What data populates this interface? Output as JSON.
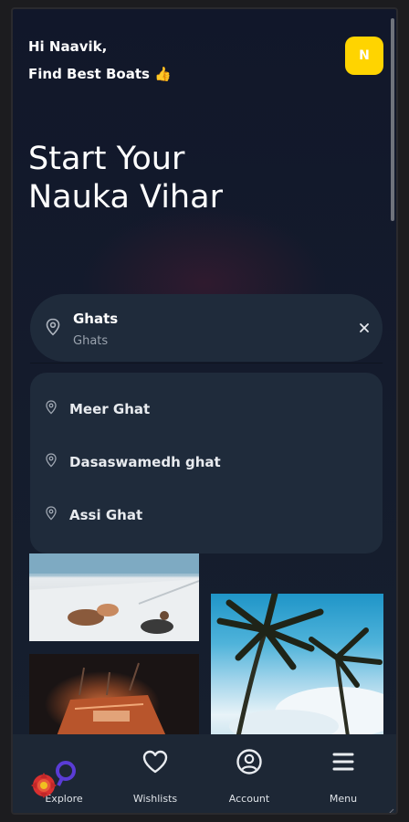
{
  "greeting": {
    "line1": "Hi Naavik,",
    "line2": "Find Best Boats 👍"
  },
  "avatar": {
    "initial": "N",
    "color": "#ffd400"
  },
  "hero": {
    "line1": "Start Your",
    "line2": "Nauka Vihar"
  },
  "search": {
    "title": "Ghats",
    "subtitle": "Ghats",
    "leading_icon": "location-pin-icon",
    "trailing_icon": "close-icon"
  },
  "suggestions": [
    {
      "label": "Meer Ghat",
      "icon": "location-pin-icon"
    },
    {
      "label": "Dasaswamedh ghat",
      "icon": "location-pin-icon"
    },
    {
      "label": "Assi Ghat",
      "icon": "location-pin-icon"
    }
  ],
  "nav": [
    {
      "label": "Explore",
      "icon": "compass-icon"
    },
    {
      "label": "Wishlists",
      "icon": "heart-icon"
    },
    {
      "label": "Account",
      "icon": "user-circle-icon"
    },
    {
      "label": "Menu",
      "icon": "menu-icon"
    }
  ],
  "colors": {
    "background": "#131a2b",
    "card": "#1f2b3b",
    "accent": "#ffd400"
  }
}
